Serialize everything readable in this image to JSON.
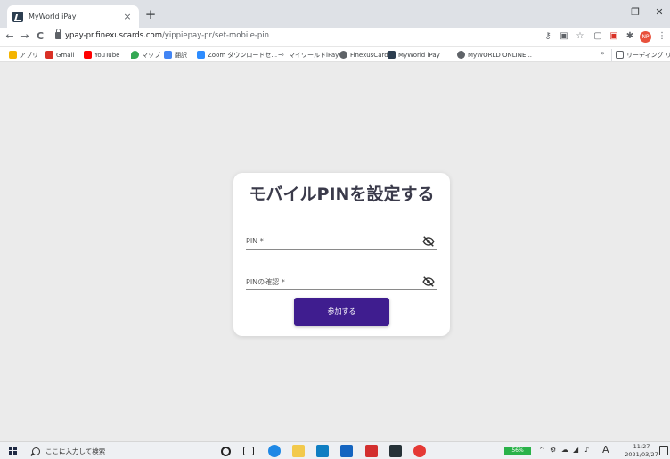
{
  "browser": {
    "tab_title": "MyWorld iPay",
    "tab_close": "×",
    "new_tab": "+",
    "window_controls": {
      "minimize": "−",
      "maximize": "❐",
      "close": "✕"
    },
    "nav": {
      "back": "←",
      "forward": "→",
      "reload": "C"
    },
    "url_host": "ypay-pr.finexuscards.com",
    "url_path": "/yippiepay-pr/set-mobile-pin",
    "extension_badge": "NP"
  },
  "bookmarks": {
    "items": [
      {
        "label": "アプリ",
        "color": "#f4b400"
      },
      {
        "label": "Gmail",
        "color": "#d93025"
      },
      {
        "label": "YouTube",
        "color": "#ff0000"
      },
      {
        "label": "マップ",
        "color": "#34a853"
      },
      {
        "label": "翻訳",
        "color": "#4285f4"
      },
      {
        "label": "Zoom ダウンロードセ...",
        "color": "#2d8cff"
      },
      {
        "label": "マイワールドiPay",
        "color": "#9aa0a6"
      },
      {
        "label": "FinexusCard",
        "color": "#5f6368"
      },
      {
        "label": "MyWorld iPay",
        "color": "#2c3e50"
      },
      {
        "label": "MyWORLD ONLINE...",
        "color": "#5f6368"
      }
    ],
    "more": "»",
    "reading_list": "リーディング リスト"
  },
  "form": {
    "title": "モバイルPINを設定する",
    "pin_label": "PIN *",
    "pin_confirm_label": "PINの確認 *",
    "submit_label": "参加する",
    "accent_color": "#3f1d8f"
  },
  "taskbar": {
    "search_placeholder": "ここに入力して検索",
    "battery": "56%",
    "ime": "A",
    "time": "11:27",
    "date": "2021/03/27"
  }
}
